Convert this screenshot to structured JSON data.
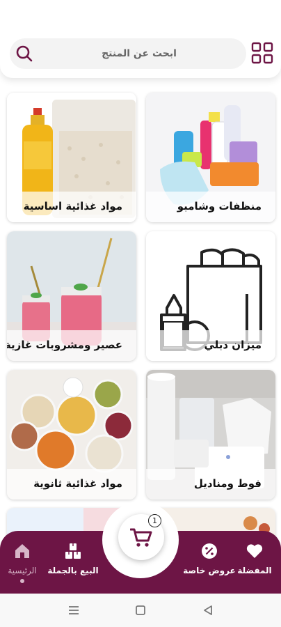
{
  "header": {
    "search_placeholder": "ابحث عن المنتج",
    "grid_icon": "grid-icon",
    "search_icon": "search-icon"
  },
  "categories": [
    {
      "label": "منظفات وشامبو",
      "icon": "cleaning-products-image"
    },
    {
      "label": "مواد غذائية اساسية",
      "icon": "oil-and-rice-image"
    },
    {
      "label": "ميزان دبلي",
      "icon": "grocery-bag-icon"
    },
    {
      "label": "عصير ومشروبات غازية",
      "icon": "juice-jars-image"
    },
    {
      "label": "فوط ومناديل",
      "icon": "paper-towels-image"
    },
    {
      "label": "مواد غذائية ثانوية",
      "icon": "legumes-bowls-image"
    }
  ],
  "bottom_nav": {
    "items": [
      {
        "label": "المفضلة",
        "icon": "heart-icon"
      },
      {
        "label": "عروض خاصة",
        "icon": "percent-badge-icon"
      },
      {
        "label": "البيع بالجملة",
        "icon": "boxes-icon"
      },
      {
        "label": "الرئيسية",
        "icon": "home-icon",
        "active": true
      }
    ],
    "cart_count": "1",
    "cart_icon": "cart-icon"
  },
  "colors": {
    "brand": "#6d1545",
    "nav_active": "#d7b6c8",
    "search_bg": "#f3f3f3"
  }
}
